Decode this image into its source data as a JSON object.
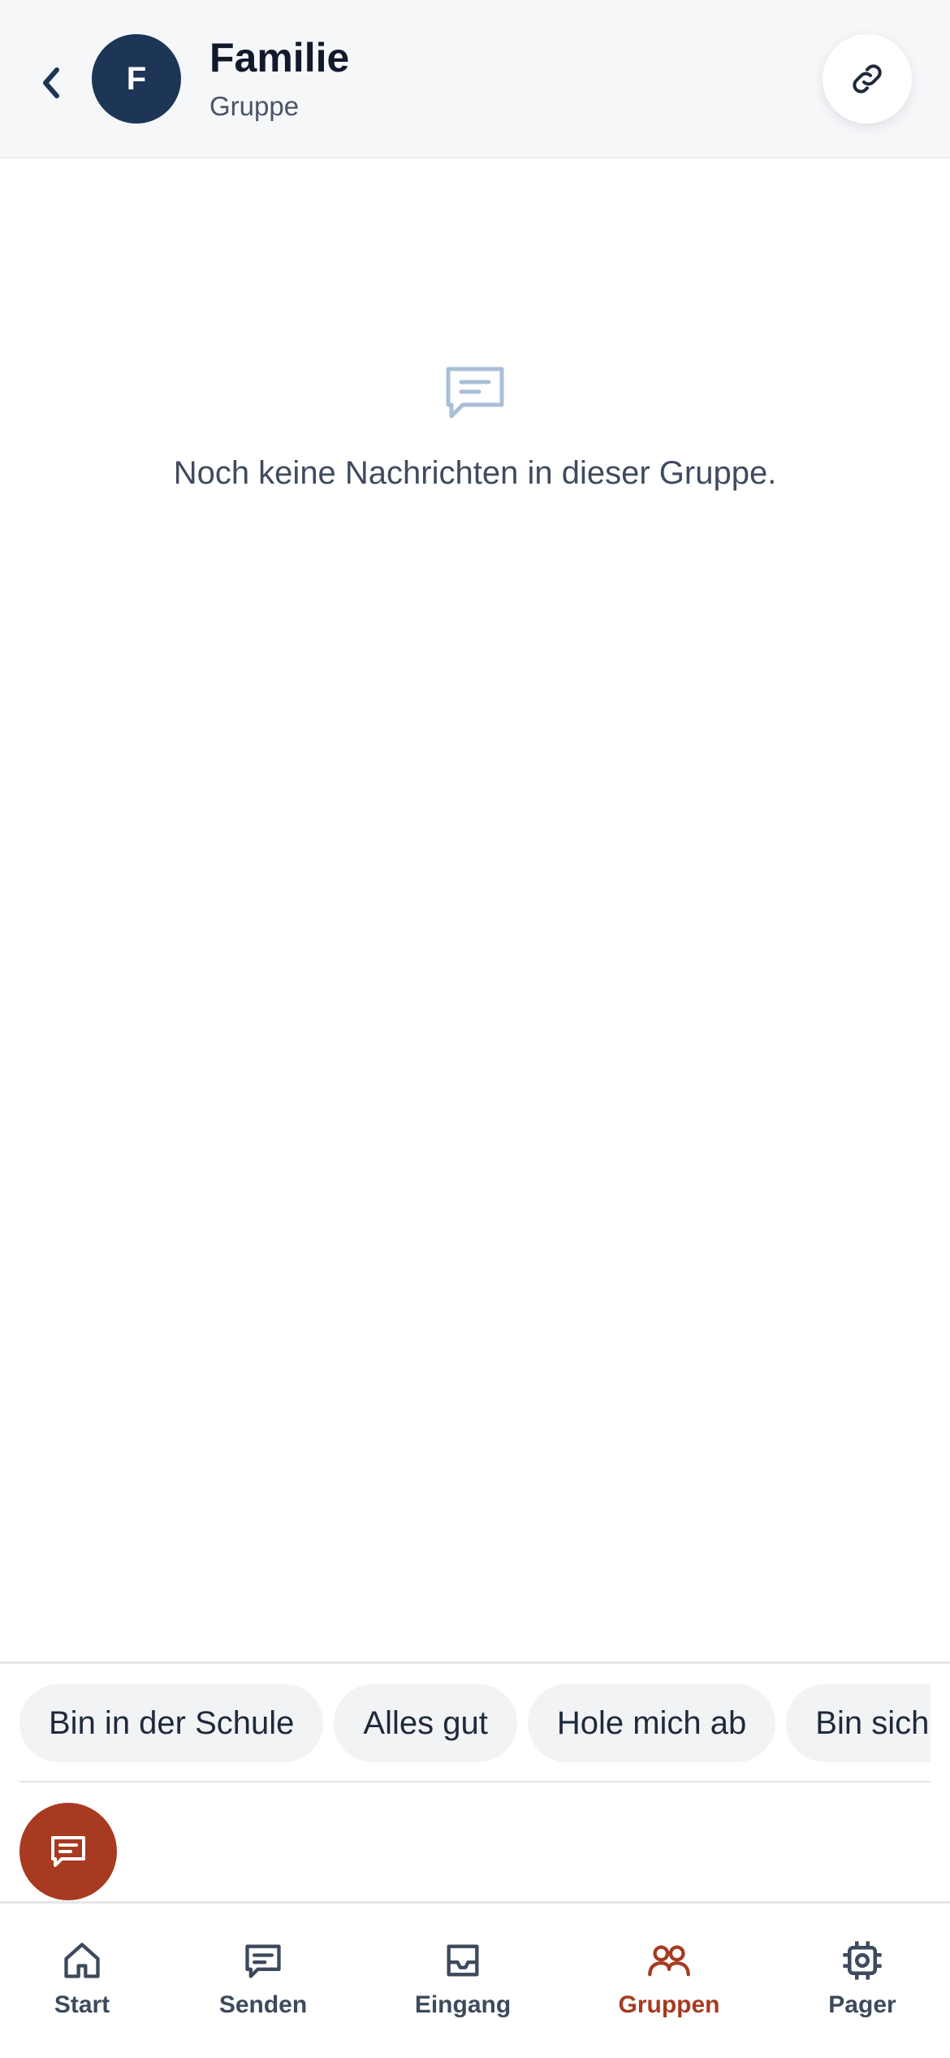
{
  "header": {
    "back_icon": "chevron-left-icon",
    "avatar_initial": "F",
    "title": "Familie",
    "subtitle": "Gruppe",
    "link_icon": "link-icon"
  },
  "empty_state": {
    "icon": "message-icon",
    "text": "Noch keine Nachrichten in dieser Gruppe."
  },
  "quick_replies": [
    "Bin in der Schule",
    "Alles gut",
    "Hole mich ab",
    "Bin sicher zu Hause"
  ],
  "compose": {
    "icon": "message-icon"
  },
  "nav": {
    "items": [
      {
        "label": "Start",
        "icon": "home-icon"
      },
      {
        "label": "Senden",
        "icon": "message-icon"
      },
      {
        "label": "Eingang",
        "icon": "inbox-icon"
      },
      {
        "label": "Gruppen",
        "icon": "users-icon",
        "active": true
      },
      {
        "label": "Pager",
        "icon": "chip-icon"
      }
    ]
  },
  "colors": {
    "accent": "#a83a21",
    "avatar_bg": "#1d3557",
    "header_bg": "#f6f7f9"
  }
}
